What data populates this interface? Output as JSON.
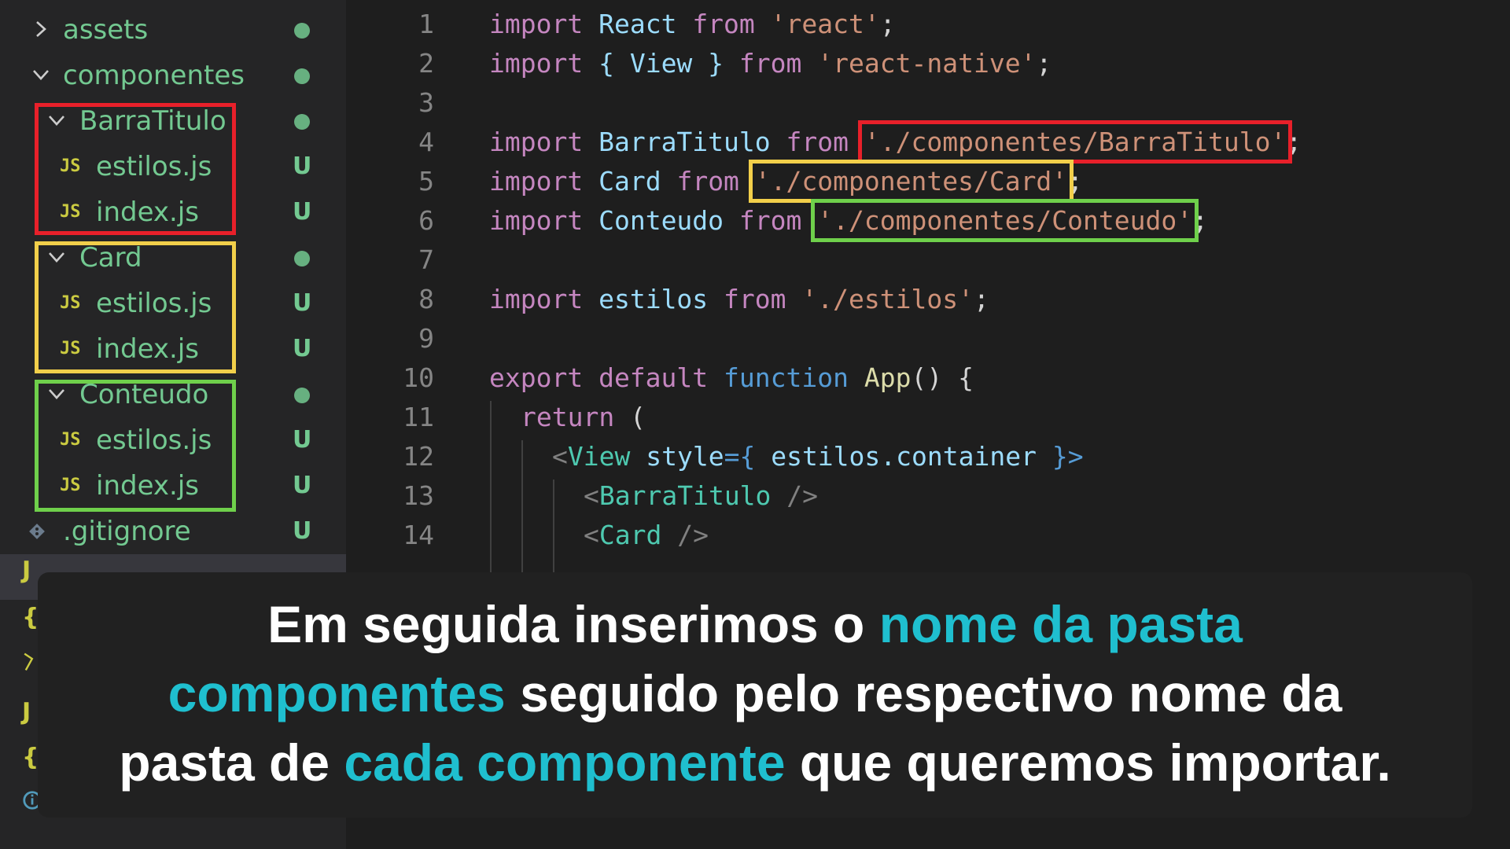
{
  "explorer": {
    "items": [
      {
        "label": "assets",
        "status": "dot"
      },
      {
        "label": "componentes",
        "status": "dot"
      },
      {
        "label": "BarraTitulo",
        "status": "dot"
      },
      {
        "label": "estilos.js",
        "status": "U"
      },
      {
        "label": "index.js",
        "status": "U"
      },
      {
        "label": "Card",
        "status": "dot"
      },
      {
        "label": "estilos.js",
        "status": "U"
      },
      {
        "label": "index.js",
        "status": "U"
      },
      {
        "label": "Conteudo",
        "status": "dot"
      },
      {
        "label": "estilos.js",
        "status": "U"
      },
      {
        "label": "index.js",
        "status": "U"
      },
      {
        "label": ".gitignore",
        "status": "U"
      }
    ],
    "js_badge": "JS",
    "partial_icons": [
      "J",
      "{",
      "J",
      "{",
      "i"
    ]
  },
  "editor": {
    "line_numbers": [
      "1",
      "2",
      "3",
      "4",
      "5",
      "6",
      "7",
      "8",
      "9",
      "10",
      "11",
      "12",
      "13",
      "14"
    ],
    "lines": [
      {
        "a": "import",
        "b": "React",
        "c": "from",
        "d": "'react'",
        "e": ";"
      },
      {
        "a": "import",
        "b": "{ View }",
        "c": "from",
        "d": "'react-native'",
        "e": ";"
      },
      {},
      {
        "a": "import",
        "b": "BarraTitulo",
        "c": "from",
        "d": "'./componentes/BarraTitulo'",
        "e": ";"
      },
      {
        "a": "import",
        "b": "Card",
        "c": "from",
        "d": "'./componentes/Card'",
        "e": ";"
      },
      {
        "a": "import",
        "b": "Conteudo",
        "c": "from",
        "d": "'./componentes/Conteudo'",
        "e": ";"
      },
      {},
      {
        "a": "import",
        "b": "estilos",
        "c": "from",
        "d": "'./estilos'",
        "e": ";"
      },
      {},
      {
        "a": "export default",
        "b": "function",
        "c": "App",
        "d": "() {"
      },
      {
        "a": "return",
        "b": "("
      },
      {
        "a": "<",
        "b": "View",
        "c": "style",
        "d": "={",
        "e": "estilos.container",
        "f": "}>"
      },
      {
        "a": "<",
        "b": "BarraTitulo",
        "c": "/>"
      },
      {
        "a": "<",
        "b": "Card",
        "c": "/>"
      }
    ]
  },
  "highlight_colors": {
    "red": "#e8202a",
    "yellow": "#f2cf4a",
    "green": "#6fd04b"
  },
  "caption": {
    "line1_a": "Em seguida inserimos o ",
    "line1_b": "nome da pasta",
    "line2_a": "componentes",
    "line2_b": " seguido pelo respectivo nome da",
    "line3_a": "pasta de ",
    "line3_b": "cada componente",
    "line3_c": " que queremos importar."
  },
  "colors": {
    "accent": "#1fbfcf",
    "caption_bg": "#212121",
    "editor_bg": "#1e1e1e",
    "sidebar_bg": "#252526",
    "git_green": "#73c991"
  }
}
